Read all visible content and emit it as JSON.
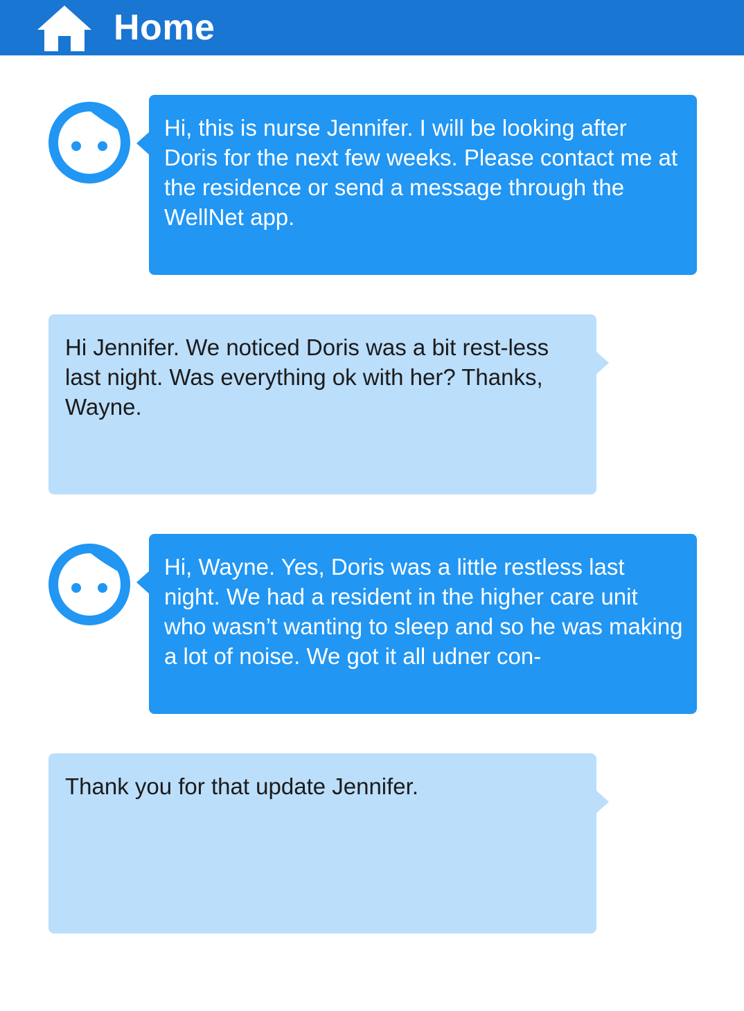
{
  "header": {
    "title": "Home",
    "icon": "home-icon",
    "color": "#1976d2"
  },
  "messages": [
    {
      "sender": "nurse",
      "text": "Hi, this is nurse Jennifer. I will be looking after Doris for the next few weeks. Please contact me at the residence or send a message through the WellNet app."
    },
    {
      "sender": "family",
      "text": "Hi Jennifer. We noticed Doris was a bit rest-less last night. Was everything ok with her? Thanks, Wayne."
    },
    {
      "sender": "nurse",
      "text": "Hi, Wayne. Yes, Doris was a little restless last night. We had a resident in the higher care unit who wasn’t wanting to sleep and so he was making a lot of noise. We got it all udner con-"
    },
    {
      "sender": "family",
      "text": "Thank you for that update Jennifer."
    }
  ],
  "colors": {
    "nurse_bubble": "#2196f3",
    "family_bubble": "#bbdefb",
    "avatar": "#2196f3"
  }
}
